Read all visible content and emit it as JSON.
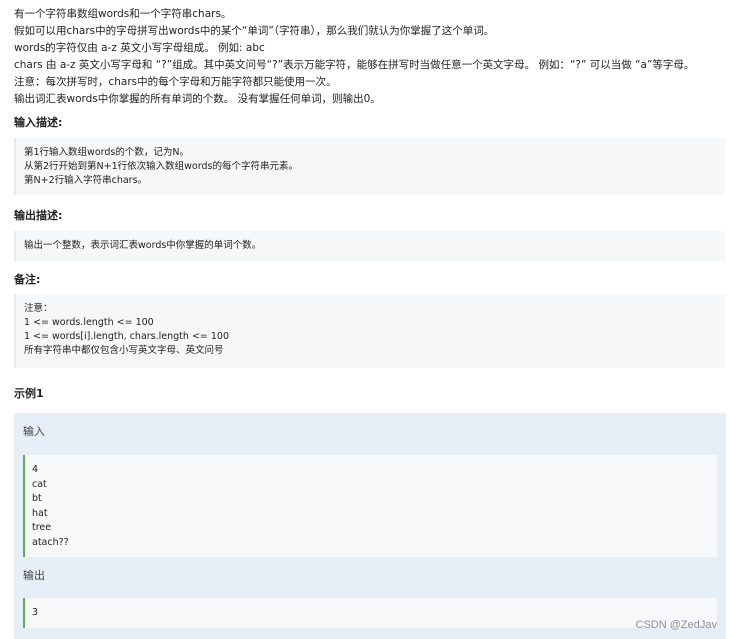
{
  "description_lines": [
    "有一个字符串数组words和一个字符串chars。",
    "假如可以用chars中的字母拼写出words中的某个“单词”（字符串），那么我们就认为你掌握了这个单词。",
    "words的字符仅由 a-z 英文小写字母组成。 例如: abc",
    "chars 由 a-z 英文小写字母和 “?”组成。其中英文问号“?”表示万能字符，能够在拼写时当做任意一个英文字母。 例如：“?” 可以当做 “a”等字母。",
    "注意：每次拼写时，chars中的每个字母和万能字符都只能使用一次。",
    "输出词汇表words中你掌握的所有单词的个数。 没有掌握任何单词，则输出0。"
  ],
  "input_section": {
    "title": "输入描述:",
    "lines": [
      "第1行输入数组words的个数，记为N。",
      "从第2行开始到第N+1行依次输入数组words的每个字符串元素。",
      "第N+2行输入字符串chars。"
    ]
  },
  "output_section": {
    "title": "输出描述:",
    "lines": [
      "输出一个整数，表示词汇表words中你掌握的单词个数。"
    ]
  },
  "notes_section": {
    "title": "备注:",
    "lines": [
      "注意：",
      "1 <= words.length <= 100",
      "1 <= words[i].length, chars.length <= 100",
      "所有字符串中都仅包含小写英文字母、英文问号"
    ]
  },
  "example": {
    "title": "示例1",
    "input_label": "输入",
    "input_lines": [
      "4",
      "cat",
      "bt",
      "hat",
      "tree",
      "atach??"
    ],
    "output_label": "输出",
    "output_lines": [
      "3"
    ]
  },
  "watermark": "CSDN @ZedJav"
}
